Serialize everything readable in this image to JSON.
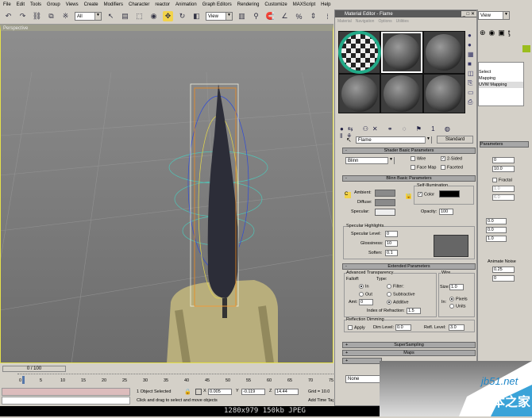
{
  "menu": [
    "File",
    "Edit",
    "Tools",
    "Group",
    "Views",
    "Create",
    "Modifiers",
    "Character",
    "reactor",
    "Animation",
    "Graph Editors",
    "Rendering",
    "Customize",
    "MAXScript",
    "Help"
  ],
  "toolbar": {
    "selection_filter": "All",
    "ref_coord": "View"
  },
  "viewport": {
    "label": "Perspective"
  },
  "material_editor": {
    "title": "Material Editor - Flame",
    "menu": [
      "Material",
      "Navigation",
      "Options",
      "Utilities"
    ],
    "material_name": "Flame",
    "material_type": "Standard",
    "shader_rollout": "Shader Basic Parameters",
    "shader": "Blinn",
    "wire": "Wire",
    "two_sided": "2-Sided",
    "face_map": "Face Map",
    "faceted": "Faceted",
    "blinn_rollout": "Blinn Basic Parameters",
    "ambient": "Ambient:",
    "diffuse": "Diffuse:",
    "specular": "Specular:",
    "self_illum": "Self-Illumination",
    "color": "Color",
    "opacity_label": "Opacity:",
    "opacity": "100",
    "spec_highlights": "Specular Highlights",
    "spec_level_label": "Specular Level:",
    "spec_level": "0",
    "gloss_label": "Glossiness:",
    "gloss": "10",
    "soften_label": "Soften:",
    "soften": "0.1",
    "extended_rollout": "Extended Parameters",
    "adv_transp": "Advanced Transparency",
    "falloff": "Falloff:",
    "in": "In",
    "out": "Out",
    "amt_label": "Amt:",
    "amt": "0",
    "type": "Type:",
    "filter": "Filter:",
    "subtractive": "Subtractive",
    "additive": "Additive",
    "ior_label": "Index of Refraction:",
    "ior": "1.5",
    "wire_group": "Wire",
    "size_label": "Size:",
    "size": "1.0",
    "in_label": "In:",
    "pixels": "Pixels",
    "units": "Units",
    "refl_dim": "Reflection Dimming",
    "apply": "Apply",
    "dim_label": "Dim Level:",
    "dim": "0.0",
    "refl_label": "Refl. Level:",
    "refl": "3.0",
    "supersampling": "SuperSampling",
    "maps": "Maps",
    "none": "None"
  },
  "command_panel": {
    "modifier_items": [
      "Select",
      "Mapping",
      "UVW Mapping"
    ],
    "params_rollout": "Parameters",
    "values": [
      "0",
      "10.0",
      "Fractal",
      "1.0",
      "6.0",
      "0.0",
      "0.0",
      "1.0",
      "Animate Noise",
      "0.25",
      "0"
    ]
  },
  "timeline": {
    "frame": "0 / 100",
    "ticks": [
      "0",
      "5",
      "10",
      "15",
      "20",
      "25",
      "30",
      "35",
      "40",
      "45",
      "50",
      "55",
      "60",
      "65",
      "70",
      "75"
    ]
  },
  "status": {
    "selected": "1 Object Selected",
    "x": "0.005",
    "y": "-0.119",
    "z": "14.44",
    "grid": "Grid = 10.0",
    "prompt": "Click and drag to select and move objects",
    "add_time": "Add Time Tag"
  },
  "caption": "1280x979  150kb  JPEG",
  "watermark": {
    "site": "jb51.net",
    "name": "脚本之家"
  }
}
